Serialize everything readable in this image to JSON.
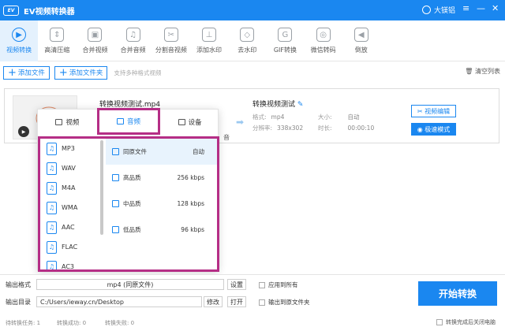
{
  "app": {
    "logo_text": "EV",
    "title": "EV视频转换器",
    "user": "大镁铝",
    "window_controls": [
      "≡",
      "—",
      "✕"
    ]
  },
  "toolbar": {
    "items": [
      {
        "label": "视频转换",
        "icon": "▶"
      },
      {
        "label": "高清压缩",
        "icon": "⇕"
      },
      {
        "label": "合并视频",
        "icon": "▣"
      },
      {
        "label": "合并音频",
        "icon": "♫"
      },
      {
        "label": "分割音视频",
        "icon": "✂"
      },
      {
        "label": "添加水印",
        "icon": "⊥"
      },
      {
        "label": "去水印",
        "icon": "◇"
      },
      {
        "label": "GIF转换",
        "icon": "G"
      },
      {
        "label": "微信转码",
        "icon": "◎"
      },
      {
        "label": "倒放",
        "icon": "◀"
      }
    ]
  },
  "actions": {
    "add_file": "添加文件",
    "add_folder": "添加文件夹",
    "hint": "支持多种格式视频",
    "clear": "清空列表"
  },
  "file": {
    "name": "转换视频测试.mp4",
    "output_name": "转换视频测试",
    "format_label": "格式:",
    "format_value": "mp4",
    "size_label": "大小:",
    "size_value": "自动",
    "resolution_label": "分辨率:",
    "resolution_value": "338x302",
    "duration_label": "时长:",
    "duration_value": "00:00:10",
    "audio_track": "音",
    "edit_btn": "视频编辑",
    "fast_btn": "极速模式"
  },
  "popup": {
    "tabs": [
      {
        "label": "视频"
      },
      {
        "label": "音频"
      },
      {
        "label": "设备"
      }
    ],
    "formats": [
      "MP3",
      "WAV",
      "M4A",
      "WMA",
      "AAC",
      "FLAC",
      "AC3"
    ],
    "qualities": [
      {
        "label": "同原文件",
        "value": "自动"
      },
      {
        "label": "高品质",
        "value": "256 kbps"
      },
      {
        "label": "中品质",
        "value": "128 kbps"
      },
      {
        "label": "低品质",
        "value": "96 kbps"
      }
    ]
  },
  "bottom": {
    "output_format_label": "输出格式",
    "output_format_value": "mp4 (同原文件)",
    "settings_btn": "设置",
    "apply_all": "应用到所有",
    "output_dir_label": "输出目录",
    "output_dir_value": "C:/Users/ieway.cn/Desktop",
    "modify_btn": "修改",
    "open_btn": "打开",
    "output_to_source": "输出到原文件夹",
    "start_btn": "开始转换",
    "pending": "待转换任务: 1",
    "success": "转换成功: 0",
    "failed": "转换失败: 0",
    "shutdown": "转换完成后关闭电脑"
  }
}
